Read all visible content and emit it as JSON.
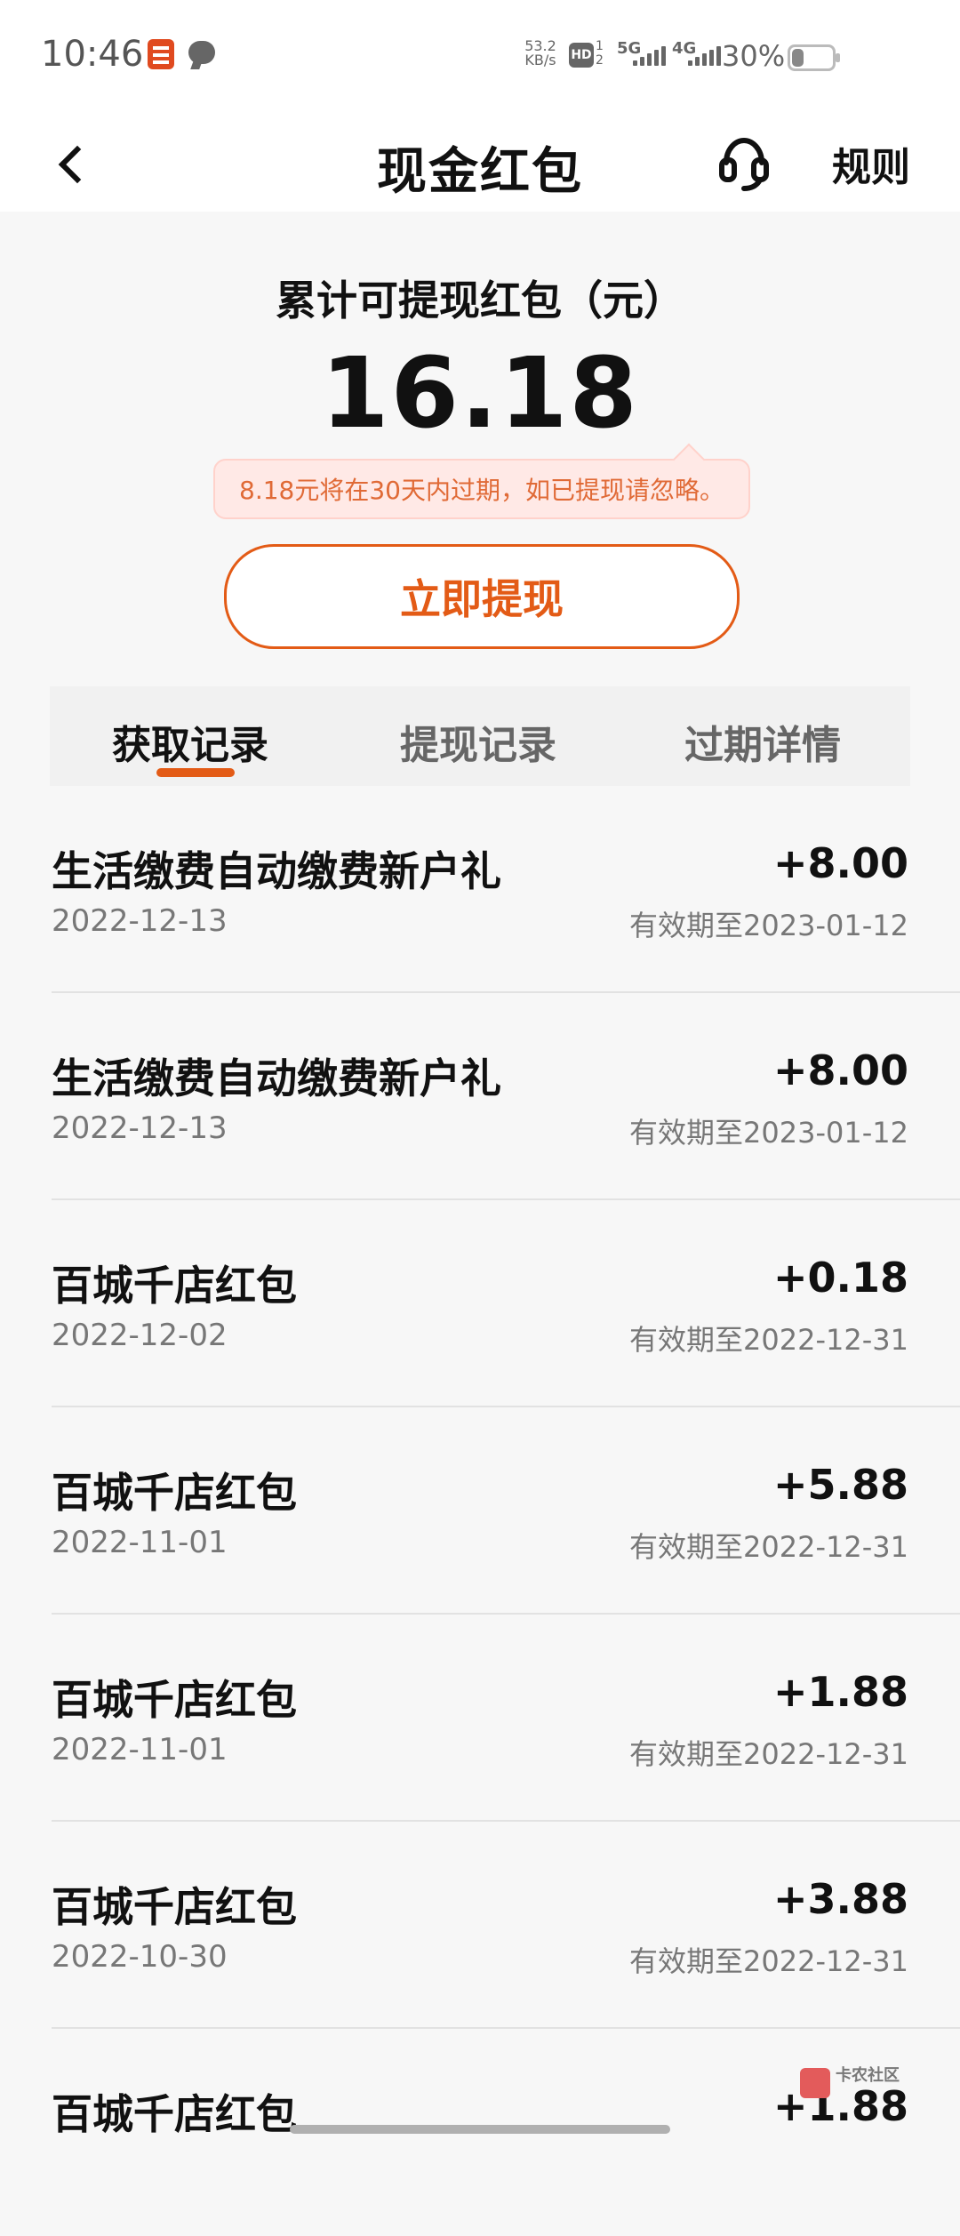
{
  "status_bar": {
    "time": "10:46",
    "network_speed_value": "53.2",
    "network_speed_unit": "KB/s",
    "hd_label": "HD",
    "hd_sim_top": "1",
    "hd_sim_bottom": "2",
    "signal_5g_label": "5G",
    "signal_4g_label": "4G",
    "battery_percent_text": "30%",
    "battery_level": 0.3,
    "icons": [
      "app-icon",
      "message-icon",
      "hd-icon",
      "signal-icon",
      "battery-icon"
    ]
  },
  "header": {
    "title": "现金红包",
    "rules_label": "规则",
    "icons": [
      "back-icon",
      "headset-icon"
    ]
  },
  "summary": {
    "title": "累计可提现红包（元）",
    "balance": "16.18",
    "notice": "8.18元将在30天内过期，如已提现请忽略。",
    "withdraw_button_label": "立即提现"
  },
  "tabs": [
    {
      "label": "获取记录",
      "active": true
    },
    {
      "label": "提现记录",
      "active": false
    },
    {
      "label": "过期详情",
      "active": false
    }
  ],
  "records": [
    {
      "title": "生活缴费自动缴费新户礼",
      "date": "2022-12-13",
      "amount": "+8.00",
      "expiry": "有效期至2023-01-12"
    },
    {
      "title": "生活缴费自动缴费新户礼",
      "date": "2022-12-13",
      "amount": "+8.00",
      "expiry": "有效期至2023-01-12"
    },
    {
      "title": "百城千店红包",
      "date": "2022-12-02",
      "amount": "+0.18",
      "expiry": "有效期至2022-12-31"
    },
    {
      "title": "百城千店红包",
      "date": "2022-11-01",
      "amount": "+5.88",
      "expiry": "有效期至2022-12-31"
    },
    {
      "title": "百城千店红包",
      "date": "2022-11-01",
      "amount": "+1.88",
      "expiry": "有效期至2022-12-31"
    },
    {
      "title": "百城千店红包",
      "date": "2022-10-30",
      "amount": "+3.88",
      "expiry": "有效期至2022-12-31"
    },
    {
      "title": "百城千店红包",
      "date": "",
      "amount": "+1.88",
      "expiry": ""
    }
  ],
  "watermark": {
    "text": "卡农社区"
  },
  "colors": {
    "accent": "#e35b16",
    "background": "#f7f7f7",
    "notice_bg": "#ffe9e6",
    "notice_text": "#e06a36"
  }
}
